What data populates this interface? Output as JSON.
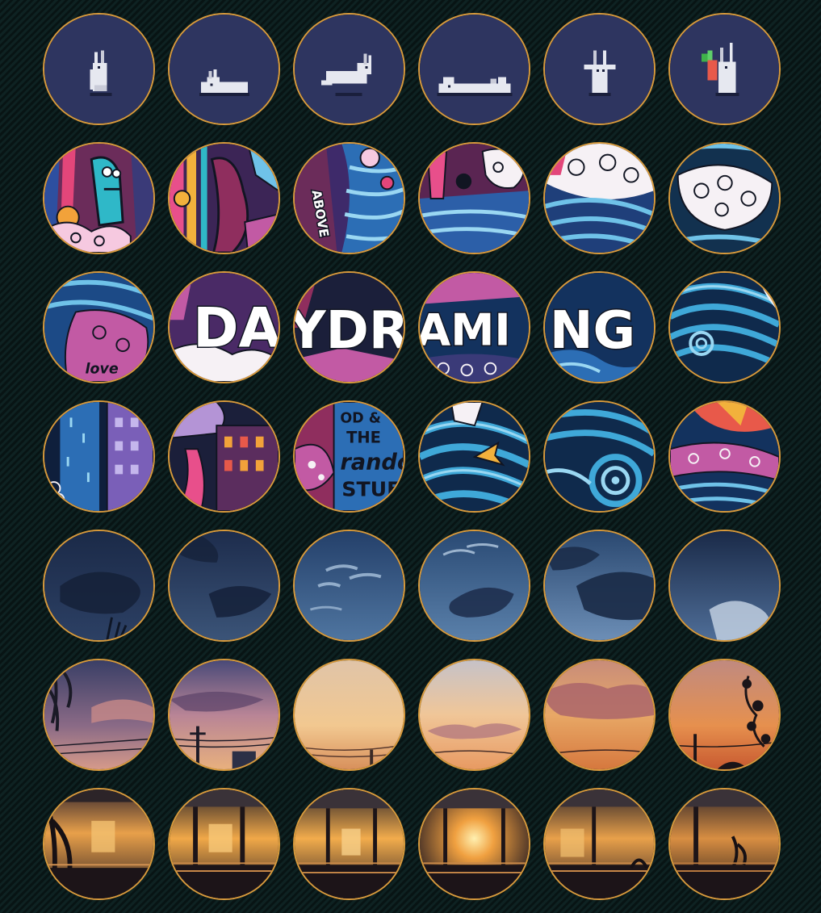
{
  "sticker_grid": {
    "accent_border": "#d89a3c",
    "rows": [
      {
        "theme": "pixel-bunny",
        "items": [
          "bunny-sitting",
          "bunny-lying",
          "bunny-jumping",
          "bunny-flat",
          "bunny-waving",
          "bunny-carrot"
        ]
      },
      {
        "theme": "doodle-art",
        "items": [
          "doodle-creature",
          "doodle-tentacle",
          "doodle-above",
          "doodle-clouds",
          "doodle-wave-flower",
          "doodle-swirl-cloud"
        ]
      },
      {
        "theme": "doodle-lettering",
        "items": [
          "doodle-love",
          "letters-da",
          "letters-ydr",
          "letters-amj",
          "letters-ng",
          "doodle-wave"
        ]
      },
      {
        "theme": "doodle-city",
        "items": [
          "doodle-city-rain",
          "doodle-city-building",
          "doodle-stuff-sign",
          "doodle-fish-wave",
          "doodle-spiral",
          "doodle-flower-reef"
        ]
      },
      {
        "theme": "night-sky",
        "items": [
          "sky-night-1",
          "sky-night-2",
          "sky-night-3",
          "sky-night-4",
          "sky-night-5",
          "sky-night-6"
        ]
      },
      {
        "theme": "sunset-sky",
        "items": [
          "sunset-leaves",
          "sunset-pole",
          "sunset-glow",
          "sunset-clouds",
          "sunset-orange",
          "sunset-vines"
        ]
      },
      {
        "theme": "sunset-station",
        "items": [
          "station-1",
          "station-2",
          "station-3",
          "station-4",
          "station-5",
          "station-6"
        ]
      }
    ],
    "text": {
      "above": "ABOVE",
      "love": "love",
      "da": "DA",
      "ydr": "YDR",
      "amj": "AMI",
      "ng": "NG",
      "stuff_1": "OD &",
      "stuff_2": "THE",
      "stuff_3": "rando",
      "stuff_4": "STUF"
    }
  }
}
